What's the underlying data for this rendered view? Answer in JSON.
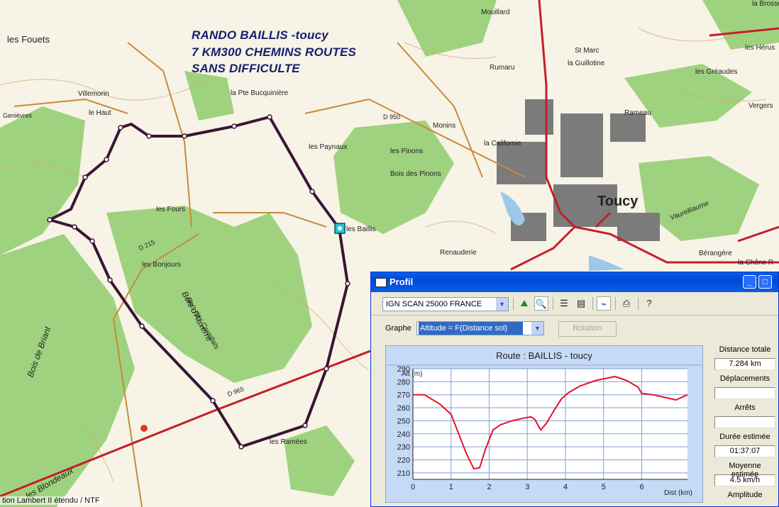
{
  "map": {
    "title_lines": [
      "RANDO BAILLIS -toucy",
      "7 KM300 CHEMINS ROUTES",
      "SANS DIFFICULTE"
    ],
    "places": [
      "les Fouets",
      "Villemorin",
      "le Haut",
      "la Pte Bucquinière",
      "les Paynaux",
      "les Pinons",
      "Bois des Pinons",
      "les Fours",
      "les Bonjours",
      "Bois des Cornillats",
      "Bois d'Auxerre",
      "Bois de Briant",
      "les Blondeaux",
      "les Ramées",
      "les Baillis",
      "la Californie",
      "Toucy",
      "Rumaru",
      "la Guillotine",
      "les Gréaudes",
      "Rameau",
      "Vergers",
      "Vaurelliaume",
      "Bérangère",
      "la Chêne R",
      "Renauderie",
      "Monins",
      "Genièvres",
      "Mouillard",
      "la Brosse",
      "St Marc",
      "les Hérus"
    ],
    "roads": [
      "D 965",
      "D 950",
      "D 215"
    ],
    "projection_note": "tion Lambert II étendu / NTF",
    "route_color": "#3a1535",
    "road_color": "#c41e2a"
  },
  "window": {
    "title": "Profil",
    "controls": {
      "minimize": "_",
      "maximize": "□",
      "close": "✕"
    },
    "toolbar": {
      "map_source": "IGN SCAN 25000 FRANCE",
      "icons": [
        "profile-icon",
        "zoom-icon",
        "list-icon",
        "properties-icon",
        "graph-icon",
        "print-icon",
        "help-icon"
      ]
    },
    "graphe_label": "Graphe",
    "graphe_value": "Altitude = F(Distance sol)",
    "rotation_label": "Rotation",
    "stats": [
      {
        "label": "Distance totale",
        "value": "7.284 km"
      },
      {
        "label": "Déplacements",
        "value": ""
      },
      {
        "label": "Arrêts",
        "value": ""
      },
      {
        "label": "Durée estimée",
        "value": "01:37:07"
      },
      {
        "label": "Moyenne estimée",
        "value": "4.5 km/h"
      },
      {
        "label": "Amplitude",
        "value": ""
      }
    ]
  },
  "chart_data": {
    "type": "line",
    "title": "Route : BAILLIS - toucy",
    "ylabel": "Alt (m)",
    "xlabel": "Dist (km)",
    "xlim": [
      0,
      7.2
    ],
    "ylim": [
      205,
      290
    ],
    "x_ticks": [
      0,
      1,
      2,
      3,
      4,
      5,
      6
    ],
    "y_ticks": [
      210,
      220,
      230,
      240,
      250,
      260,
      270,
      280,
      290
    ],
    "grid": true,
    "line_color": "#e8102a",
    "series": [
      {
        "x": [
          0,
          0.3,
          0.7,
          1.0,
          1.2,
          1.4,
          1.6,
          1.75,
          1.9,
          2.1,
          2.3,
          2.6,
          2.9,
          3.1,
          3.2,
          3.35,
          3.5,
          3.7,
          3.9,
          4.1,
          4.4,
          4.8,
          5.3,
          5.6,
          5.9,
          6.0,
          6.3,
          6.6,
          6.9,
          7.2
        ],
        "y": [
          270,
          270,
          263,
          255,
          240,
          225,
          213,
          214,
          228,
          243,
          247,
          250,
          252,
          253,
          251,
          243,
          248,
          258,
          267,
          272,
          277,
          281,
          284,
          281,
          276,
          271,
          270,
          268,
          266,
          270
        ]
      }
    ]
  }
}
